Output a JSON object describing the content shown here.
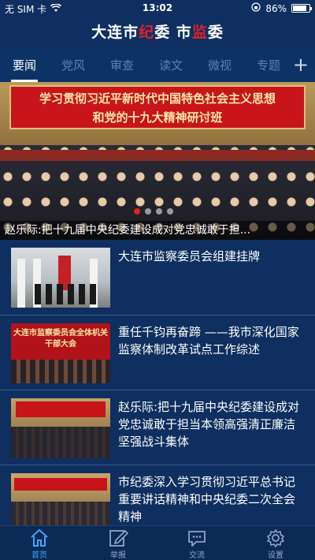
{
  "status_bar": {
    "carrier": "无 SIM 卡",
    "time": "13:02",
    "battery": "86%",
    "battery_level": 0.86
  },
  "header": {
    "title_part1": "大连市",
    "title_accent1": "纪",
    "title_part2": "委 市",
    "title_accent2": "监",
    "title_part3": "委"
  },
  "tabs": [
    {
      "label": "要闻",
      "active": true
    },
    {
      "label": "党风",
      "active": false
    },
    {
      "label": "审查",
      "active": false
    },
    {
      "label": "读文",
      "active": false
    },
    {
      "label": "微视",
      "active": false
    },
    {
      "label": "专题",
      "active": false
    }
  ],
  "tab_add_label": "+",
  "banner": {
    "sign_line1": "学习贯彻习近平新时代中国特色社会主义思想",
    "sign_line2": "和党的十九大精神研讨班",
    "caption": "赵乐际:把十九届中央纪委建设成对党忠诚敢于担...",
    "slide_count": 4,
    "active_slide": 1
  },
  "news": [
    {
      "title": "大连市监察委员会组建挂牌"
    },
    {
      "title": "重任千钧再奋蹄 ——我市深化国家监察体制改革试点工作综述",
      "thumb_text": "大连市监察委员会全体机关干部大会"
    },
    {
      "title": "赵乐际:把十九届中央纪委建设成对党忠诚敢于担当本领高强清正廉洁坚强战斗集体"
    },
    {
      "title": "市纪委深入学习贯彻习近平总书记重要讲话精神和中央纪委二次全会精神"
    }
  ],
  "bottom_nav": [
    {
      "label": "首页",
      "icon": "home-icon",
      "active": true
    },
    {
      "label": "举报",
      "icon": "report-edit-icon",
      "active": false
    },
    {
      "label": "交流",
      "icon": "chat-icon",
      "active": false
    },
    {
      "label": "设置",
      "icon": "gear-icon",
      "active": false
    }
  ],
  "colors": {
    "background": "#0e2f5f",
    "accent_red": "#e0222a",
    "active_nav": "#3fa8ff"
  }
}
